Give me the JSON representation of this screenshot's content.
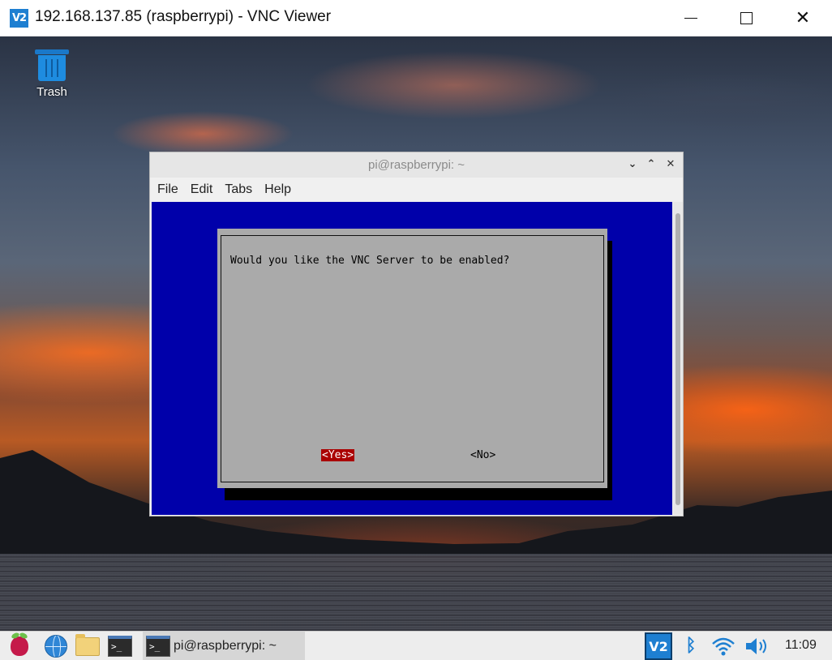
{
  "window": {
    "app_icon": "vnc-viewer-icon",
    "app_icon_text": "V2",
    "title": "192.168.137.85 (raspberrypi) - VNC Viewer"
  },
  "desktop": {
    "trash_label": "Trash"
  },
  "terminal": {
    "title": "pi@raspberrypi: ~",
    "menu": [
      "File",
      "Edit",
      "Tabs",
      "Help"
    ],
    "dialog": {
      "prompt": "Would you like the VNC Server to be enabled?",
      "yes_label": "<Yes>",
      "no_label": "<No>",
      "selected": "yes"
    },
    "colors": {
      "screen_bg": "#0000aa",
      "dialog_bg": "#aaaaaa",
      "button_selected_bg": "#aa0000"
    }
  },
  "taskbar": {
    "launchers": [
      "raspberry-pi-menu-icon",
      "web-browser-icon",
      "file-manager-icon",
      "terminal-icon"
    ],
    "terminal_glyph": ">_",
    "task_label": "pi@raspberrypi: ~",
    "tray_vnc_text": "V2",
    "tray": [
      "vnc-server-icon",
      "bluetooth-icon",
      "wifi-icon",
      "volume-icon"
    ],
    "clock": "11:09"
  }
}
